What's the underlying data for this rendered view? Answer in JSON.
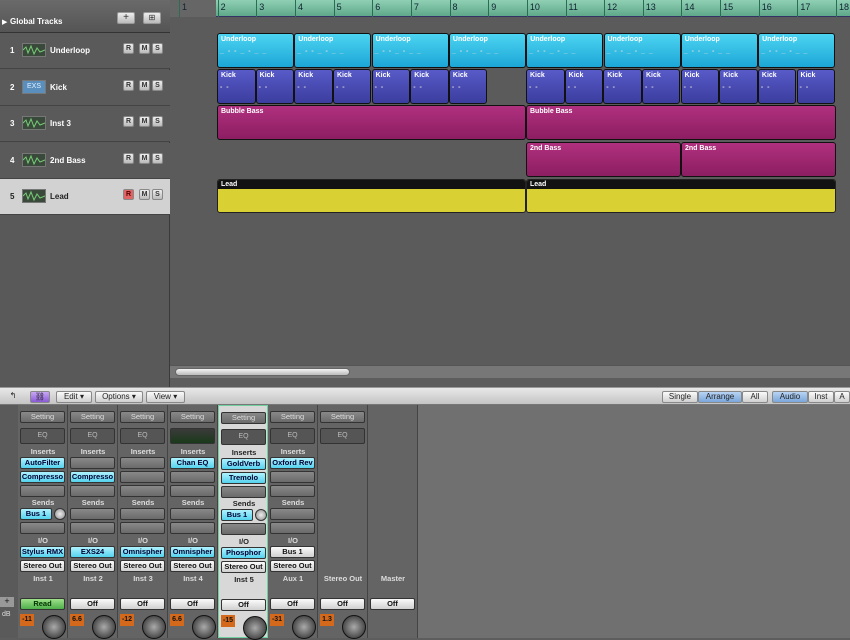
{
  "global_tracks": {
    "label": "Global Tracks"
  },
  "tracks": [
    {
      "num": "1",
      "name": "Underloop",
      "icon": "waveform-icon"
    },
    {
      "num": "2",
      "name": "Kick",
      "icon": "exs-icon",
      "icon_text": "EXS"
    },
    {
      "num": "3",
      "name": "Inst 3",
      "icon": "waveform-icon"
    },
    {
      "num": "4",
      "name": "2nd Bass",
      "icon": "waveform-icon"
    },
    {
      "num": "5",
      "name": "Lead",
      "icon": "waveform-icon"
    }
  ],
  "rms": {
    "r": "R",
    "m": "M",
    "s": "S"
  },
  "ruler": [
    "1",
    "2",
    "3",
    "4",
    "5",
    "6",
    "7",
    "8",
    "9",
    "10",
    "11",
    "12",
    "13",
    "14",
    "15",
    "16",
    "17",
    "18"
  ],
  "regions": {
    "underloop": "Underloop",
    "kick": "Kick",
    "bubble": "Bubble Bass",
    "bass2": "2nd Bass",
    "lead": "Lead"
  },
  "toolbar": {
    "edit": "Edit",
    "options": "Options",
    "view": "View",
    "single": "Single",
    "arrange": "Arrange",
    "all": "All",
    "audio": "Audio",
    "inst": "Inst",
    "aux": "A"
  },
  "mixer": {
    "labels": {
      "setting": "Setting",
      "eq": "EQ",
      "inserts": "Inserts",
      "sends": "Sends",
      "io": "I/O",
      "db": "dB"
    },
    "strips": [
      {
        "insert1": "AutoFilter",
        "insert2": "Compresso",
        "send": "Bus 1",
        "input": "Stylus RMX",
        "output": "Stereo Out",
        "name": "Inst 1",
        "auto": "Read",
        "meter": "-11"
      },
      {
        "insert1": "",
        "insert2": "Compresso",
        "send": "",
        "input": "EXS24",
        "output": "Stereo Out",
        "name": "Inst 2",
        "auto": "Off",
        "meter": "6.6"
      },
      {
        "insert1": "",
        "insert2": "",
        "send": "",
        "input": "Omnispher",
        "output": "Stereo Out",
        "name": "Inst 3",
        "auto": "Off",
        "meter": "-12"
      },
      {
        "insert1": "Chan EQ",
        "insert2": "",
        "send": "",
        "input": "Omnispher",
        "output": "Stereo Out",
        "name": "Inst 4",
        "auto": "Off",
        "meter": "6.6"
      },
      {
        "insert1": "GoldVerb",
        "insert2": "Tremolo",
        "send": "Bus 1",
        "input": "Phosphor",
        "output": "Stereo Out",
        "name": "Inst 5",
        "auto": "Off",
        "meter": "-15"
      },
      {
        "insert1": "Oxford Rev",
        "insert2": "",
        "send": "",
        "input": "Bus 1",
        "output": "Stereo Out",
        "name": "Aux 1",
        "auto": "Off",
        "meter": "-31"
      },
      {
        "insert1": "",
        "insert2": "",
        "send": "",
        "input": "",
        "output": "",
        "name": "Stereo Out",
        "auto": "Off",
        "meter": "1.3"
      },
      {
        "name": "Master",
        "auto": "Off"
      }
    ]
  },
  "colors": {
    "cyan": "#1ca6d6",
    "blue": "#3b3d9e",
    "magenta": "#8c1e62",
    "yellow": "#d9d133",
    "ruler": "#5fa88a"
  }
}
